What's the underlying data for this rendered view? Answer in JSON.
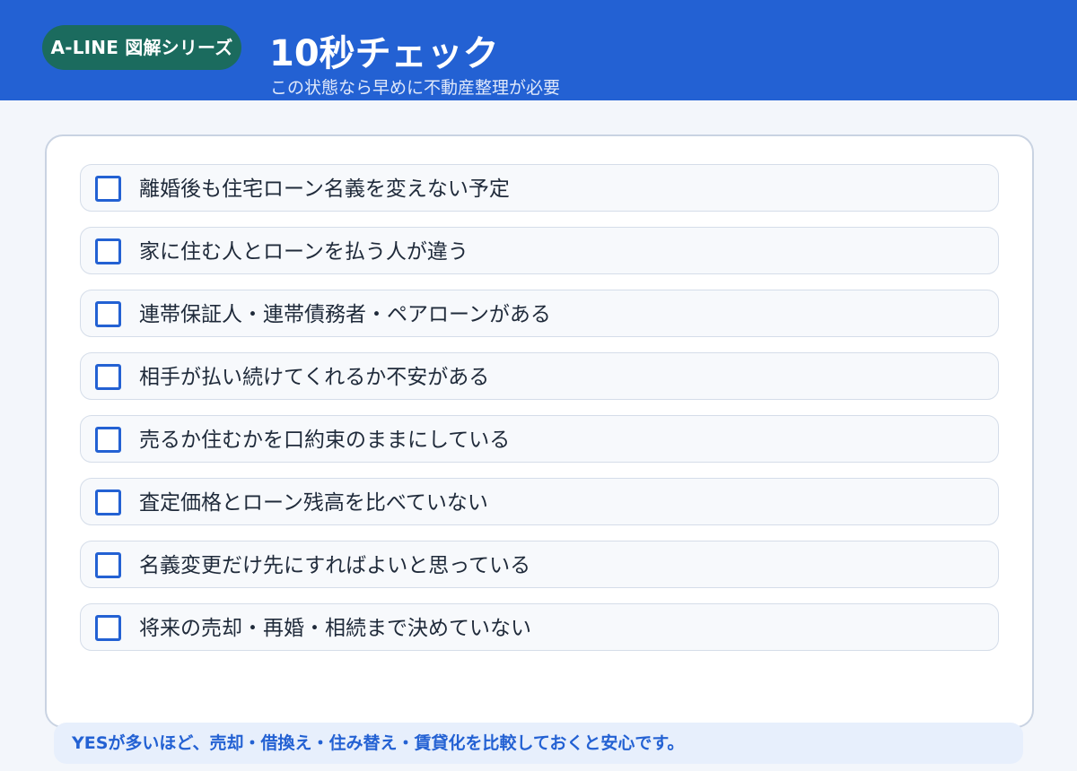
{
  "header": {
    "badge": "A-LINE 図解シリーズ",
    "title": "10秒チェック",
    "subtitle": "この状態なら早めに不動産整理が必要"
  },
  "checklist": {
    "items": [
      {
        "label": "離婚後も住宅ローン名義を変えない予定",
        "checked": false
      },
      {
        "label": "家に住む人とローンを払う人が違う",
        "checked": false
      },
      {
        "label": "連帯保証人・連帯債務者・ペアローンがある",
        "checked": false
      },
      {
        "label": "相手が払い続けてくれるか不安がある",
        "checked": false
      },
      {
        "label": "売るか住むかを口約束のままにしている",
        "checked": false
      },
      {
        "label": "査定価格とローン残高を比べていない",
        "checked": false
      },
      {
        "label": "名義変更だけ先にすればよいと思っている",
        "checked": false
      },
      {
        "label": "将来の売却・再婚・相続まで決めていない",
        "checked": false
      }
    ]
  },
  "footer": {
    "note": "YESが多いほど、売却・借換え・住み替え・賃貸化を比較しておくと安心です。"
  },
  "colors": {
    "header_bg": "#2361d3",
    "badge_bg": "#1b6b5e",
    "accent": "#2361d3",
    "page_bg": "#f3f6fb"
  }
}
